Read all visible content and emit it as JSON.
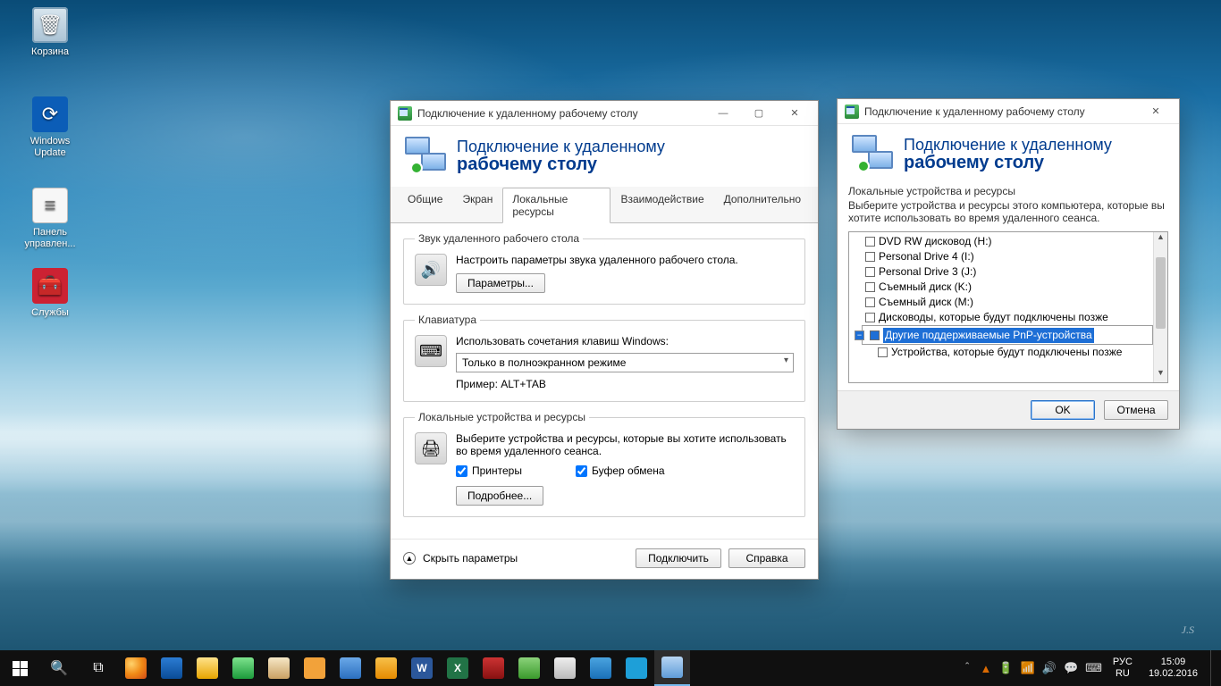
{
  "desktop_icons": {
    "recycle": "Корзина",
    "winupdate": "Windows Update",
    "panel": "Панель управлен...",
    "services": "Службы"
  },
  "win1": {
    "title": "Подключение к удаленному рабочему столу",
    "head1": "Подключение к удаленному",
    "head2": "рабочему столу",
    "tabs": {
      "t0": "Общие",
      "t1": "Экран",
      "t2": "Локальные ресурсы",
      "t3": "Взаимодействие",
      "t4": "Дополнительно"
    },
    "grp_audio": "Звук удаленного рабочего стола",
    "audio_text": "Настроить параметры звука удаленного рабочего стола.",
    "audio_btn": "Параметры...",
    "grp_kb": "Клавиатура",
    "kb_text": "Использовать сочетания клавиш Windows:",
    "kb_option": "Только в полноэкранном режиме",
    "kb_example": "Пример: ALT+TAB",
    "grp_local": "Локальные устройства и ресурсы",
    "local_text": "Выберите устройства и ресурсы, которые вы хотите использовать во время удаленного сеанса.",
    "chk_printers": "Принтеры",
    "chk_clipboard": "Буфер обмена",
    "more_btn": "Подробнее...",
    "hide_params": "Скрыть параметры",
    "connect": "Подключить",
    "help": "Справка"
  },
  "win2": {
    "title": "Подключение к удаленному рабочему столу",
    "head1": "Подключение к удаленному",
    "head2": "рабочему столу",
    "subhead": "Локальные устройства и ресурсы",
    "desc": "Выберите устройства и ресурсы этого компьютера, которые вы хотите использовать во время удаленного сеанса.",
    "items": {
      "i0": "DVD RW дисковод (H:)",
      "i1": "Personal Drive 4 (I:)",
      "i2": "Personal Drive 3 (J:)",
      "i3": "Съемный диск (K:)",
      "i4": "Съемный диск (M:)",
      "i5": "Дисководы, которые будут подключены позже",
      "i6": "Другие поддерживаемые PnP-устройства",
      "i7": "Устройства, которые будут подключены позже"
    },
    "ok": "OK",
    "cancel": "Отмена"
  },
  "tray": {
    "lang1": "РУС",
    "lang2": "RU",
    "time": "15:09",
    "date": "19.02.2016"
  }
}
